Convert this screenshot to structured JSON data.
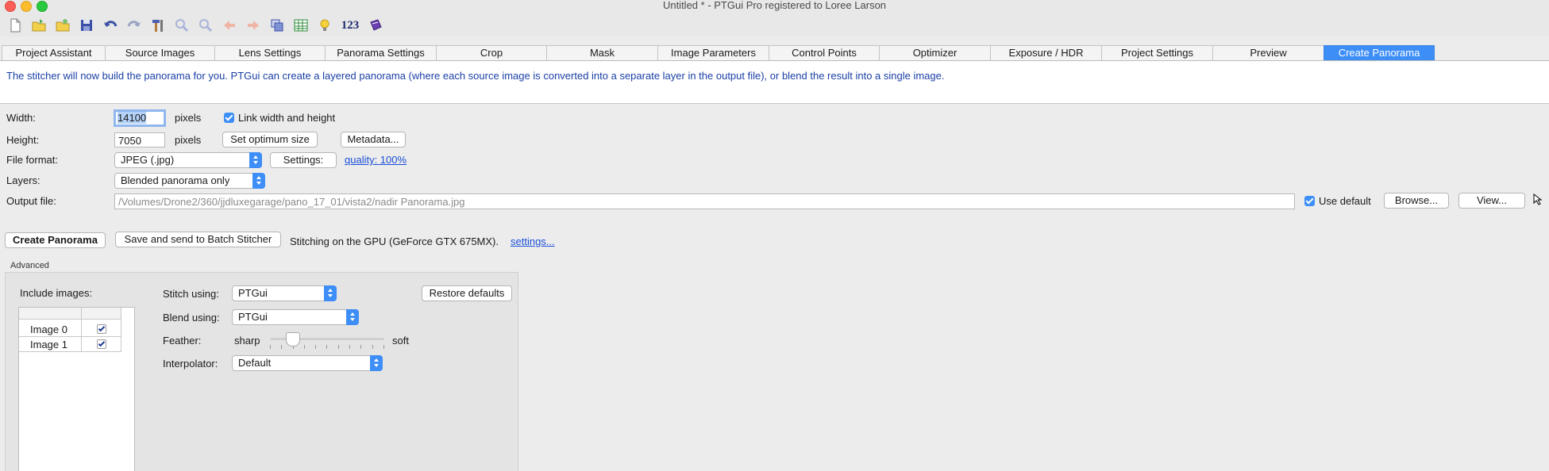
{
  "window": {
    "title": "Untitled * - PTGui Pro registered to Loree Larson"
  },
  "toolbar": {
    "icons": [
      "new-document-icon",
      "open-folder-icon",
      "open-recent-icon",
      "save-icon",
      "undo-icon",
      "redo-icon",
      "tools-icon",
      "zoom-in-icon",
      "zoom-out-icon",
      "back-icon",
      "forward-icon",
      "panorama-editor-icon",
      "table-icon",
      "lightbulb-icon",
      "numbers-icon",
      "book-icon"
    ],
    "numbers_label": "123"
  },
  "tabs": [
    {
      "label": "Project Assistant",
      "active": false
    },
    {
      "label": "Source Images",
      "active": false
    },
    {
      "label": "Lens Settings",
      "active": false
    },
    {
      "label": "Panorama Settings",
      "active": false
    },
    {
      "label": "Crop",
      "active": false
    },
    {
      "label": "Mask",
      "active": false
    },
    {
      "label": "Image Parameters",
      "active": false
    },
    {
      "label": "Control Points",
      "active": false
    },
    {
      "label": "Optimizer",
      "active": false
    },
    {
      "label": "Exposure / HDR",
      "active": false
    },
    {
      "label": "Project Settings",
      "active": false
    },
    {
      "label": "Preview",
      "active": false
    },
    {
      "label": "Create Panorama",
      "active": true
    }
  ],
  "info_text": "The stitcher will now build the panorama for you. PTGui can create a layered panorama (where each source image is converted into a separate layer in the output file), or blend the result into a single image.",
  "form": {
    "width_label": "Width:",
    "width_value": "14100",
    "height_label": "Height:",
    "height_value": "7050",
    "pixels_label": "pixels",
    "link_label": "Link width and height",
    "set_optimum_label": "Set optimum size",
    "metadata_label": "Metadata...",
    "file_format_label": "File format:",
    "file_format_value": "JPEG (.jpg)",
    "settings_label": "Settings:",
    "quality_link": "quality: 100%",
    "layers_label": "Layers:",
    "layers_value": "Blended panorama only",
    "output_file_label": "Output file:",
    "output_file_value": "/Volumes/Drone2/360/jjdluxegarage/pano_17_01/vista2/nadir Panorama.jpg",
    "use_default_label": "Use default",
    "browse_label": "Browse...",
    "view_label": "View..."
  },
  "actions": {
    "create_label": "Create Panorama",
    "batch_label": "Save and send to Batch Stitcher",
    "gpu_text": "Stitching on the GPU (GeForce GTX 675MX).",
    "gpu_settings_link": "settings..."
  },
  "advanced": {
    "title": "Advanced",
    "include_images_label": "Include images:",
    "images": [
      {
        "name": "Image 0",
        "included": true
      },
      {
        "name": "Image 1",
        "included": true
      }
    ],
    "stitch_using_label": "Stitch using:",
    "stitch_using_value": "PTGui",
    "blend_using_label": "Blend using:",
    "blend_using_value": "PTGui",
    "feather_label": "Feather:",
    "feather_min": "sharp",
    "feather_max": "soft",
    "feather_level": 0.2,
    "interpolator_label": "Interpolator:",
    "interpolator_value": "Default",
    "restore_label": "Restore defaults"
  },
  "colors": {
    "accent": "#3d8ef7",
    "info_text": "#1a3fa6",
    "link": "#1a4fd6"
  }
}
